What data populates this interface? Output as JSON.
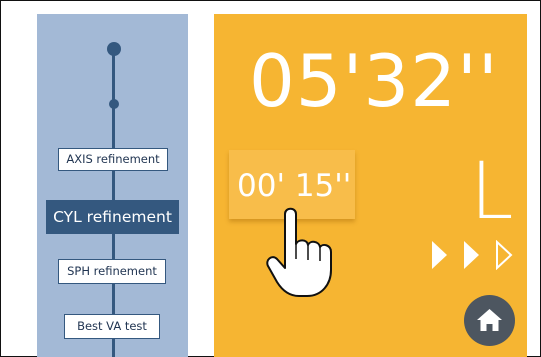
{
  "progress": {
    "steps": [
      {
        "label": "AXIS refinement"
      },
      {
        "label": "CYL refinement"
      },
      {
        "label": "SPH refinement"
      },
      {
        "label": "Best VA test"
      }
    ],
    "active_step": "CYL refinement"
  },
  "main": {
    "total_time": "05'32''",
    "step_timer": "00' 15''",
    "eye": "L",
    "next_arrows": [
      "filled-play-icon",
      "filled-play-icon",
      "outline-play-icon"
    ],
    "home_icon": "home-icon"
  },
  "colors": {
    "sidebar_bg": "#a3b9d6",
    "sidebar_accent": "#34587f",
    "main_bg": "#f6b532",
    "home_button": "#4d5660"
  }
}
